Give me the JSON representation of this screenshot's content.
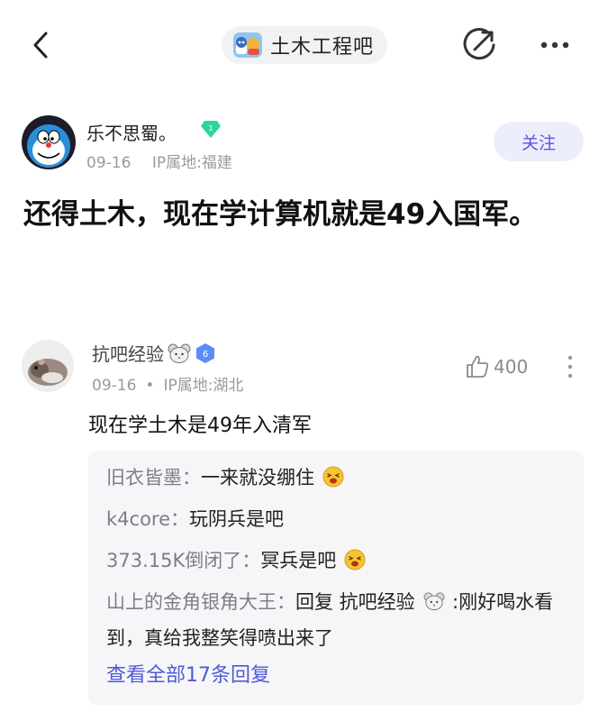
{
  "header": {
    "forum_name": "土木工程吧",
    "icons": [
      "back-arrow-icon",
      "forum-logo-icon",
      "edit-share-icon",
      "more-icon"
    ]
  },
  "post": {
    "author": {
      "name": "乐不思蜀。",
      "badge_level": "1",
      "date": "09-16",
      "location": "IP属地:福建"
    },
    "follow_label": "关注",
    "title": "还得土木，现在学计算机就是49入国军。"
  },
  "comment": {
    "name": "抗吧经验",
    "level": "6",
    "date": "09-16",
    "separator": "•",
    "location": "IP属地:湖北",
    "likes": "400",
    "text": "现在学土木是49年入清军",
    "replies": [
      {
        "name": "旧衣皆墨",
        "sep": "：",
        "text": "一来就没绷住"
      },
      {
        "name": "k4core",
        "sep": "：",
        "text": "玩阴兵是吧"
      },
      {
        "name": "373.15K倒闭了",
        "sep": "：",
        "text": "冥兵是吧"
      },
      {
        "name": "山上的金角银角大王",
        "sep": "：",
        "text_prefix": "回复 抗吧经验",
        "text_suffix": " :刚好喝水看到，真给我整笑得喷出来了"
      }
    ],
    "view_all_label": "查看全部17条回复"
  },
  "colors": {
    "accent": "#5a56e0",
    "link": "#4f5bd5",
    "badge_green": "#2fd3a1",
    "badge_blue": "#5b8bf5"
  }
}
